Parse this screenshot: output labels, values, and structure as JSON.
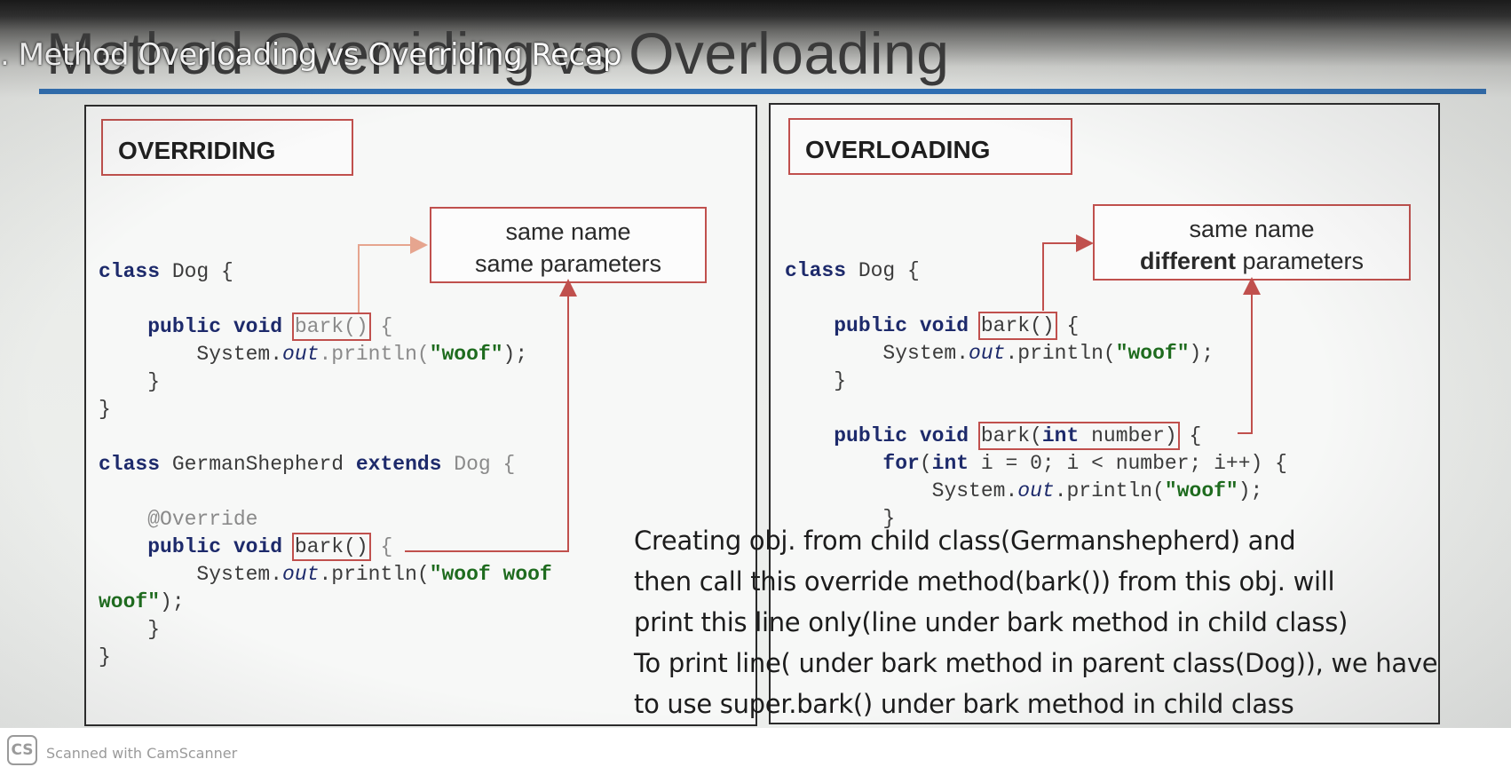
{
  "slide": {
    "title": "Method Overriding vs Overloading",
    "lecture_overlay": ". Method Overloading vs Overriding Recap"
  },
  "overriding": {
    "heading": "OVERRIDING",
    "callout_line1": "same name",
    "callout_line2": "same parameters",
    "code": {
      "class_dog": "class",
      "dog_name": " Dog {",
      "public_void": "public void",
      "bark": "bark()",
      "brace_open": " {",
      "sysout_prefix": "System.",
      "out": "out",
      "println_prefix": ".println(",
      "woof": "\"woof\"",
      "println_suffix": ");",
      "close_inner": "}",
      "close_outer": "}",
      "class_kw": "class",
      "german_name": " GermanShepherd ",
      "extends_kw": "extends",
      "extends_dog": " Dog {",
      "override_ann": "@Override",
      "public_void2": "public void",
      "bark2": "bark()",
      "brace_open2": " {",
      "sysout_prefix2": "System.",
      "out2": "out",
      "println_prefix2": ".println(",
      "woof_woof1": "\"woof woof",
      "woof_woof2": "woof\"",
      "println_suffix2": ");",
      "close_inner2": "}",
      "close_outer2": "}"
    }
  },
  "overloading": {
    "heading": "OVERLOADING",
    "callout_line1": "same name",
    "callout_bold": "different",
    "callout_rest": " parameters",
    "code": {
      "class_kw": "class",
      "dog_name": " Dog {",
      "public_void": "public void",
      "bark": "bark()",
      "brace_open": " {",
      "sysout_prefix": "System.",
      "out": "out",
      "println_prefix": ".println(",
      "woof": "\"woof\"",
      "println_suffix": ");",
      "close_inner": "}",
      "public_void2": "public void",
      "bark_int_open": "bark(",
      "int_kw": "int",
      "bark_int_close": " number)",
      "brace_open2": " {",
      "for_kw": "for",
      "for_paren": "(",
      "for_int": "int",
      "for_rest": " i = 0; i < number; i++) {",
      "sysout_prefix2": "System.",
      "out2": "out",
      "println_prefix2": ".println(",
      "woof2": "\"woof\"",
      "println_suffix2": ");",
      "close_loop": "}"
    }
  },
  "handwritten_note": {
    "line1": "Creating obj. from child class(Germanshepherd) and",
    "line2": " then call this override method(bark()) from this obj. will",
    "line3": " print this line only(line under bark method in child class)",
    "line4": "To print line( under bark method in parent class(Dog)), we have",
    "line5": "to use super.bark() under bark method in child class"
  },
  "footer": {
    "logo": "CS",
    "text": "Scanned with CamScanner"
  },
  "colors": {
    "accent_red": "#c0504d",
    "title_rule_blue": "#2f6fb3",
    "keyword_navy": "#1d2a6b",
    "string_green": "#1e6b1e"
  }
}
